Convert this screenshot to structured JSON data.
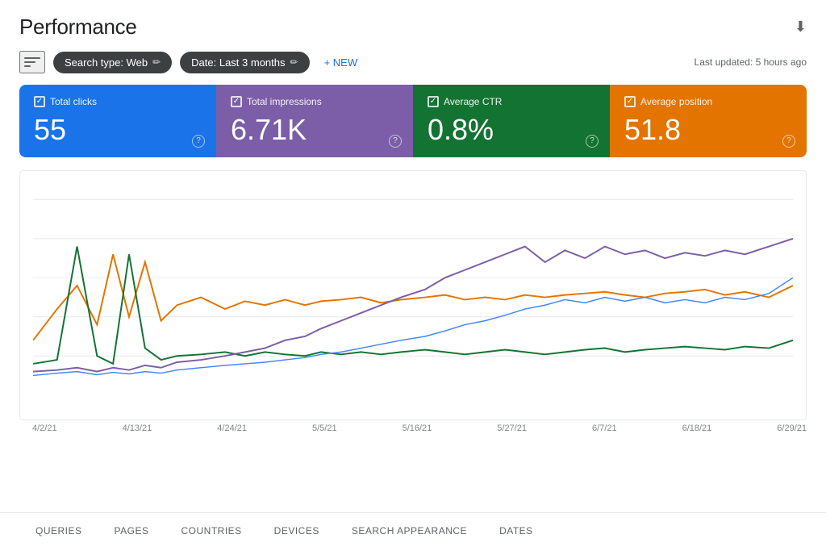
{
  "header": {
    "title": "Performance",
    "last_updated": "Last updated: 5 hours ago"
  },
  "toolbar": {
    "filter_label": "Filter",
    "search_type_chip": "Search type: Web",
    "date_chip": "Date: Last 3 months",
    "new_button": "+ NEW"
  },
  "metrics": [
    {
      "id": "total-clicks",
      "label": "Total clicks",
      "value": "55",
      "color": "blue",
      "checked": true
    },
    {
      "id": "total-impressions",
      "label": "Total impressions",
      "value": "6.71K",
      "color": "purple",
      "checked": true
    },
    {
      "id": "average-ctr",
      "label": "Average CTR",
      "value": "0.8%",
      "color": "teal",
      "checked": true
    },
    {
      "id": "average-position",
      "label": "Average position",
      "value": "51.8",
      "color": "orange",
      "checked": true
    }
  ],
  "chart": {
    "date_labels": [
      "4/2/21",
      "4/13/21",
      "4/24/21",
      "5/5/21",
      "5/16/21",
      "5/27/21",
      "6/7/21",
      "6/18/21",
      "6/29/21"
    ]
  },
  "bottom_tabs": [
    {
      "id": "queries",
      "label": "QUERIES",
      "active": false
    },
    {
      "id": "pages",
      "label": "PAGES",
      "active": false
    },
    {
      "id": "countries",
      "label": "COUNTRIES",
      "active": false
    },
    {
      "id": "devices",
      "label": "DEVICES",
      "active": false
    },
    {
      "id": "search-appearance",
      "label": "SEARCH APPEARANCE",
      "active": false
    },
    {
      "id": "dates",
      "label": "DATES",
      "active": false
    }
  ]
}
